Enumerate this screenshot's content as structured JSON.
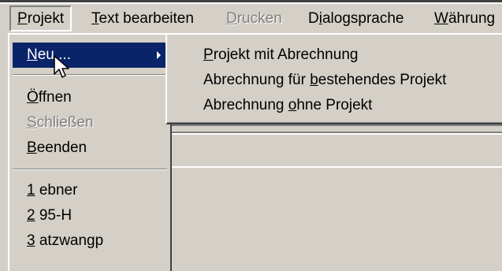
{
  "menubar": {
    "items": [
      {
        "pre": "",
        "u": "P",
        "post": "rojekt"
      },
      {
        "pre": "",
        "u": "T",
        "post": "ext bearbeiten"
      },
      {
        "pre": "",
        "u": "D",
        "post": "rucken"
      },
      {
        "pre": "D",
        "u": "i",
        "post": "alogsprache"
      },
      {
        "pre": "",
        "u": "W",
        "post": "ährung"
      }
    ]
  },
  "projekt_menu": {
    "neu": {
      "pre": "",
      "u": "N",
      "post": "eu ..."
    },
    "oeffnen": {
      "pre": "",
      "u": "Ö",
      "post": "ffnen"
    },
    "schliessen": {
      "pre": "",
      "u": "S",
      "post": "chließen"
    },
    "beenden": {
      "pre": "",
      "u": "B",
      "post": "eenden"
    },
    "recent": [
      {
        "pre": "",
        "u": "1",
        "post": " ebner"
      },
      {
        "pre": "",
        "u": "2",
        "post": " 95-H"
      },
      {
        "pre": "",
        "u": "3",
        "post": " atzwangp"
      }
    ]
  },
  "neu_submenu": [
    {
      "pre": "",
      "u": "P",
      "post": "rojekt mit Abrechnung"
    },
    {
      "pre": "Abrechnung für ",
      "u": "b",
      "post": "estehendes Projekt"
    },
    {
      "pre": "Abrechnung ",
      "u": "o",
      "post": "hne Projekt"
    }
  ],
  "colors": {
    "highlight": "#0a246a",
    "face": "#d4d0c8",
    "disabled": "#808080"
  }
}
